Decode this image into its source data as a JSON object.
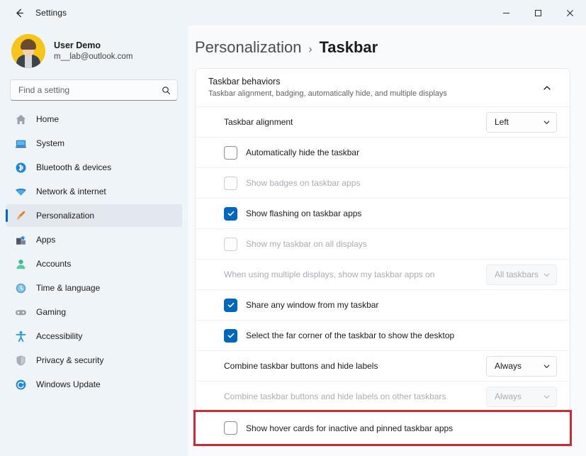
{
  "titlebar": {
    "back_icon": "arrow-left-icon",
    "app_title": "Settings",
    "minimize_label": "–",
    "maximize_label": "□",
    "close_label": "✕"
  },
  "sidebar": {
    "account": {
      "name": "User Demo",
      "email": "m__lab@outlook.com",
      "avatar_icon": "user-avatar"
    },
    "search": {
      "placeholder": "Find a setting",
      "value": "",
      "icon": "search-icon"
    },
    "items": [
      {
        "label": "Home",
        "icon": "home-icon",
        "selected": false
      },
      {
        "label": "System",
        "icon": "system-icon",
        "selected": false
      },
      {
        "label": "Bluetooth & devices",
        "icon": "bluetooth-icon",
        "selected": false
      },
      {
        "label": "Network & internet",
        "icon": "wifi-icon",
        "selected": false
      },
      {
        "label": "Personalization",
        "icon": "paintbrush-icon",
        "selected": true
      },
      {
        "label": "Apps",
        "icon": "apps-icon",
        "selected": false
      },
      {
        "label": "Accounts",
        "icon": "account-icon",
        "selected": false
      },
      {
        "label": "Time & language",
        "icon": "clock-icon",
        "selected": false
      },
      {
        "label": "Gaming",
        "icon": "gamepad-icon",
        "selected": false
      },
      {
        "label": "Accessibility",
        "icon": "accessibility-icon",
        "selected": false
      },
      {
        "label": "Privacy & security",
        "icon": "shield-icon",
        "selected": false
      },
      {
        "label": "Windows Update",
        "icon": "update-icon",
        "selected": false
      }
    ]
  },
  "main": {
    "breadcrumb": {
      "parent": "Personalization",
      "separator": "›",
      "current": "Taskbar"
    },
    "card": {
      "title": "Taskbar behaviors",
      "subtitle": "Taskbar alignment, badging, automatically hide, and multiple displays",
      "expanded": true,
      "collapse_icon": "chevron-up-icon"
    },
    "rows": [
      {
        "type": "dropdown",
        "label": "Taskbar alignment",
        "value": "Left",
        "disabled": false,
        "highlighted": false
      },
      {
        "type": "checkbox",
        "label": "Automatically hide the taskbar",
        "checked": false,
        "disabled": false,
        "highlighted": false
      },
      {
        "type": "checkbox",
        "label": "Show badges on taskbar apps",
        "checked": false,
        "disabled": true,
        "highlighted": false
      },
      {
        "type": "checkbox",
        "label": "Show flashing on taskbar apps",
        "checked": true,
        "disabled": false,
        "highlighted": false
      },
      {
        "type": "checkbox",
        "label": "Show my taskbar on all displays",
        "checked": false,
        "disabled": true,
        "highlighted": false
      },
      {
        "type": "dropdown",
        "label": "When using multiple displays, show my taskbar apps on",
        "value": "All taskbars",
        "disabled": true,
        "highlighted": false
      },
      {
        "type": "checkbox",
        "label": "Share any window from my taskbar",
        "checked": true,
        "disabled": false,
        "highlighted": false
      },
      {
        "type": "checkbox",
        "label": "Select the far corner of the taskbar to show the desktop",
        "checked": true,
        "disabled": false,
        "highlighted": false
      },
      {
        "type": "dropdown",
        "label": "Combine taskbar buttons and hide labels",
        "value": "Always",
        "disabled": false,
        "highlighted": false
      },
      {
        "type": "dropdown",
        "label": "Combine taskbar buttons and hide labels on other taskbars",
        "value": "Always",
        "disabled": true,
        "highlighted": false
      },
      {
        "type": "checkbox",
        "label": "Show hover cards for inactive and pinned taskbar apps",
        "checked": false,
        "disabled": false,
        "highlighted": true
      }
    ]
  },
  "colors": {
    "accent": "#0067C0",
    "sidebar_bg": "#EFF4F9",
    "card_bg": "#FFFFFF",
    "highlight_border": "#CC2B35",
    "avatar_bg": "#F5C518"
  }
}
